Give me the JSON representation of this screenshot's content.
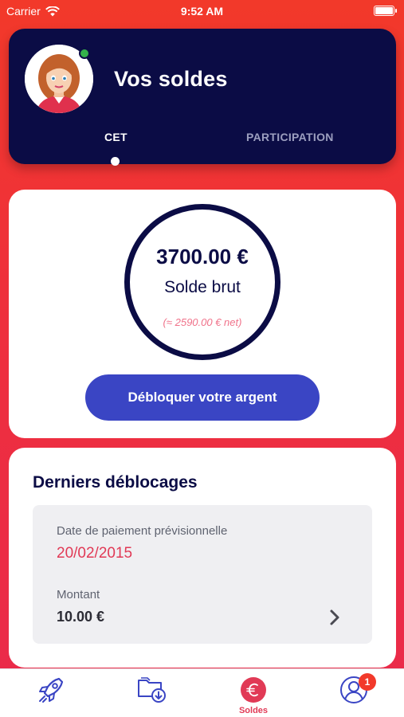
{
  "status_bar": {
    "carrier": "Carrier",
    "time": "9:52 AM"
  },
  "header": {
    "title": "Vos soldes",
    "tabs": [
      {
        "label": "CET",
        "active": true
      },
      {
        "label": "PARTICIPATION",
        "active": false
      }
    ]
  },
  "balance": {
    "amount": "3700.00 €",
    "label": "Solde brut",
    "net": "(≈ 2590.00 € net)",
    "button_label": "Débloquer votre argent"
  },
  "releases": {
    "title": "Derniers déblocages",
    "items": [
      {
        "date_label": "Date de paiement prévisionnelle",
        "date": "20/02/2015",
        "amount_label": "Montant",
        "amount": "10.00 €"
      }
    ]
  },
  "tab_bar": {
    "items": [
      {
        "icon": "rocket-icon",
        "label": ""
      },
      {
        "icon": "folder-download-icon",
        "label": ""
      },
      {
        "icon": "euro-icon",
        "label": "Soldes",
        "active": true
      },
      {
        "icon": "profile-icon",
        "label": "",
        "badge": "1"
      }
    ]
  },
  "colors": {
    "navy": "#0b0c45",
    "button_blue": "#3a45c4",
    "accent_red": "#e13a56",
    "background_red": "#f2392a",
    "online_green": "#34b24a"
  }
}
